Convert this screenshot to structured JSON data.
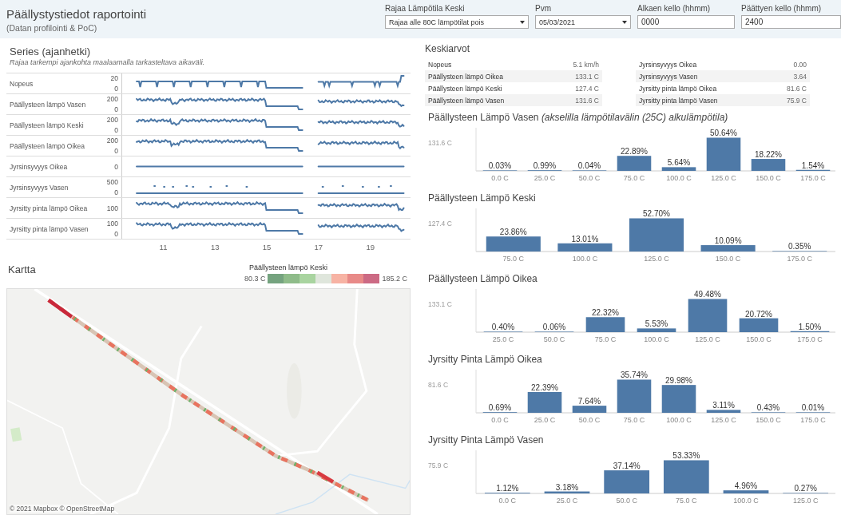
{
  "header": {
    "title": "Päällystystiedot raportointi",
    "subtitle": "(Datan profilointi & PoC)"
  },
  "filters": [
    {
      "label": "Rajaa Lämpötila Keski",
      "kind": "dropdown",
      "value": "Rajaa alle 80C lämpötilat pois"
    },
    {
      "label": "Pvm",
      "kind": "dropdown",
      "value": "05/03/2021"
    },
    {
      "label": "Alkaen kello (hhmm)",
      "kind": "input",
      "value": "0000"
    },
    {
      "label": "Päättyen kello (hhmm)",
      "kind": "input",
      "value": "2400"
    }
  ],
  "series": {
    "title": "Series (ajanhetki)",
    "subtitle": "Rajaa tarkempi ajankohta maalaamalla tarkasteltava aikaväli.",
    "rows": [
      {
        "label": "Nopeus",
        "kind": "speed",
        "ticks": [
          "20",
          "0"
        ]
      },
      {
        "label": "Päällysteen lämpö Vasen",
        "kind": "temp",
        "ticks": [
          "200",
          "0"
        ]
      },
      {
        "label": "Päällysteen lämpö Keski",
        "kind": "temp",
        "ticks": [
          "200",
          "0"
        ]
      },
      {
        "label": "Päällysteen lämpö Oikea",
        "kind": "temp",
        "ticks": [
          "200",
          "0"
        ]
      },
      {
        "label": "Jyrsinsyvyys Oikea",
        "kind": "flat",
        "ticks": [
          "0"
        ]
      },
      {
        "label": "Jyrsinsyvyys Vasen",
        "kind": "scatter",
        "ticks": [
          "500",
          "0"
        ]
      },
      {
        "label": "Jyrsitty pinta lämpö Oikea",
        "kind": "temp",
        "ticks": [
          "100"
        ]
      },
      {
        "label": "Jyrsitty pinta lämpö Vasen",
        "kind": "temp",
        "ticks": [
          "100",
          "0"
        ]
      }
    ],
    "x_ticks": [
      "11",
      "13",
      "15",
      "17",
      "19"
    ]
  },
  "map": {
    "title": "Kartta",
    "legend_title": "Päällysteen lämpö Keski",
    "legend_min": "80.3 C",
    "legend_max": "185.2 C",
    "attribution": "© 2021 Mapbox © OpenStreetMap"
  },
  "averages": {
    "title": "Keskiarvot",
    "columns": [
      [
        {
          "label": "Nopeus",
          "value": "5.1 km/h"
        },
        {
          "label": "Päällysteen lämpö Oikea",
          "value": "133.1 C"
        },
        {
          "label": "Päällysteen lämpö Keski",
          "value": "127.4 C"
        },
        {
          "label": "Päällysteen lämpö Vasen",
          "value": "131.6 C"
        }
      ],
      [
        {
          "label": "Jyrsinsyvyys Oikea",
          "value": "0.00"
        },
        {
          "label": "Jyrsinsyvyys Vasen",
          "value": "3.64"
        },
        {
          "label": "Jyrsitty pinta lämpö Oikea",
          "value": "81.6 C"
        },
        {
          "label": "Jyrsitty pinta lämpö Vasen",
          "value": "75.9 C"
        }
      ]
    ]
  },
  "histograms": [
    {
      "reference": "131.6 C",
      "chart_data": {
        "type": "bar",
        "title": "Päällysteen Lämpö Vasen *(akselilla lämpötilavälin (25C) alkulämpötila)*",
        "categories": [
          "0.0 C",
          "25.0 C",
          "50.0 C",
          "75.0 C",
          "100.0 C",
          "125.0 C",
          "150.0 C",
          "175.0 C"
        ],
        "values": [
          0.03,
          0.99,
          0.04,
          22.89,
          5.64,
          50.64,
          18.22,
          1.54
        ],
        "value_labels": [
          "0.03%",
          "0.99%",
          "0.04%",
          "22.89%",
          "5.64%",
          "50.64%",
          "18.22%",
          "1.54%"
        ]
      }
    },
    {
      "reference": "127.4 C",
      "chart_data": {
        "type": "bar",
        "title": "Päällysteen Lämpö Keski",
        "categories": [
          "75.0 C",
          "100.0 C",
          "125.0 C",
          "150.0 C",
          "175.0 C"
        ],
        "values": [
          23.86,
          13.01,
          52.7,
          10.09,
          0.35
        ],
        "value_labels": [
          "23.86%",
          "13.01%",
          "52.70%",
          "10.09%",
          "0.35%"
        ]
      }
    },
    {
      "reference": "133.1 C",
      "chart_data": {
        "type": "bar",
        "title": "Päällysteen Lämpö Oikea",
        "categories": [
          "25.0 C",
          "50.0 C",
          "75.0 C",
          "100.0 C",
          "125.0 C",
          "150.0 C",
          "175.0 C"
        ],
        "values": [
          0.4,
          0.06,
          22.32,
          5.53,
          49.48,
          20.72,
          1.5
        ],
        "value_labels": [
          "0.40%",
          "0.06%",
          "22.32%",
          "5.53%",
          "49.48%",
          "20.72%",
          "1.50%"
        ]
      }
    },
    {
      "reference": "81.6 C",
      "chart_data": {
        "type": "bar",
        "title": "Jyrsitty Pinta Lämpö Oikea",
        "categories": [
          "0.0 C",
          "25.0 C",
          "50.0 C",
          "75.0 C",
          "100.0 C",
          "125.0 C",
          "150.0 C",
          "175.0 C"
        ],
        "values": [
          0.69,
          22.39,
          7.64,
          35.74,
          29.98,
          3.11,
          0.43,
          0.01
        ],
        "value_labels": [
          "0.69%",
          "22.39%",
          "7.64%",
          "35.74%",
          "29.98%",
          "3.11%",
          "0.43%",
          "0.01%"
        ]
      }
    },
    {
      "reference": "75.9 C",
      "chart_data": {
        "type": "bar",
        "title": "Jyrsitty Pinta Lämpö Vasen",
        "categories": [
          "0.0 C",
          "25.0 C",
          "50.0 C",
          "75.0 C",
          "100.0 C",
          "125.0 C"
        ],
        "values": [
          1.12,
          3.18,
          37.14,
          53.33,
          4.96,
          0.27
        ],
        "value_labels": [
          "1.12%",
          "3.18%",
          "37.14%",
          "53.33%",
          "4.96%",
          "0.27%"
        ]
      }
    }
  ]
}
